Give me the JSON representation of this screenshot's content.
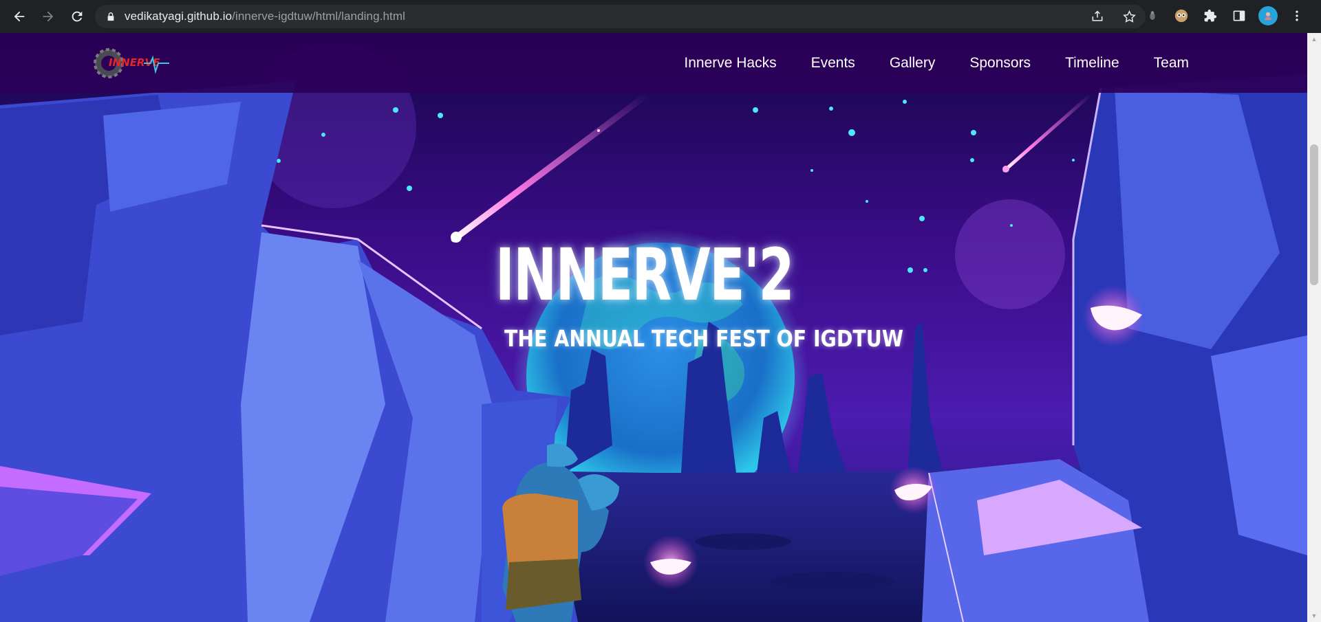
{
  "browser": {
    "url_domain": "vedikatyagi.github.io",
    "url_path": "/innerve-igdtuw/html/landing.html",
    "back_icon": "arrow-left-icon",
    "forward_icon": "arrow-right-icon",
    "reload_icon": "reload-icon",
    "share_icon": "share-icon",
    "bookmark_icon": "star-icon",
    "extensions_icon": "puzzle-icon",
    "menu_icon": "kebab-menu-icon"
  },
  "site": {
    "logo_text": "INNERVE",
    "nav": [
      {
        "label": "Innerve Hacks"
      },
      {
        "label": "Events"
      },
      {
        "label": "Gallery"
      },
      {
        "label": "Sponsors"
      },
      {
        "label": "Timeline"
      },
      {
        "label": "Team"
      }
    ],
    "hero": {
      "title": "INNERVE'2",
      "subtitle": "THE ANNUAL TECH FEST OF IGDTUW"
    }
  },
  "colors": {
    "navbar": "#2d0058",
    "sky_top": "#2a0a5e",
    "cliff_blue": "#4a5be0",
    "planet": "#2fa8d6",
    "crystal_pink": "#f08fd0"
  }
}
